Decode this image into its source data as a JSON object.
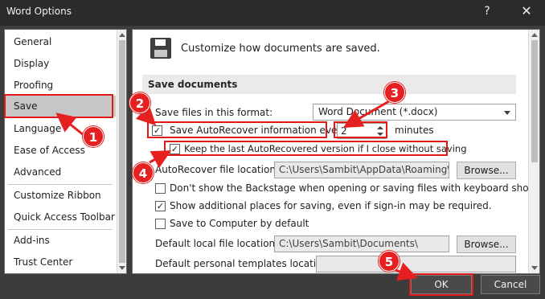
{
  "window": {
    "title": "Word Options",
    "help_label": "?",
    "close_label": "✕"
  },
  "sidebar": {
    "items": [
      {
        "label": "General"
      },
      {
        "label": "Display"
      },
      {
        "label": "Proofing"
      },
      {
        "label": "Save",
        "selected": true
      },
      {
        "label": "Language"
      },
      {
        "label": "Ease of Access"
      },
      {
        "label": "Advanced"
      },
      {
        "label": "Customize Ribbon"
      },
      {
        "label": "Quick Access Toolbar"
      },
      {
        "label": "Add-ins"
      },
      {
        "label": "Trust Center"
      }
    ]
  },
  "main": {
    "header_text": "Customize how documents are saved.",
    "header_icon": "floppy-disk-icon",
    "section_title": "Save documents",
    "save_format_label": "Save files in this format:",
    "save_format_value": "Word Document (*.docx)",
    "autorecover_label": "Save AutoRecover information every",
    "autorecover_checked": true,
    "autorecover_minutes_value": "2",
    "minutes_label": "minutes",
    "keep_last_label": "Keep the last AutoRecovered version if I close without saving",
    "keep_last_checked": true,
    "autorecover_location_label": "AutoRecover file location:",
    "autorecover_location_value": "C:\\Users\\Sambit\\AppData\\Roaming\\Microsoft\\Word\\",
    "browse_label": "Browse...",
    "dont_show_backstage_label": "Don't show the Backstage when opening or saving files with keyboard shortcuts",
    "dont_show_backstage_checked": false,
    "show_additional_label": "Show additional places for saving, even if sign-in may be required.",
    "show_additional_checked": true,
    "save_to_computer_label": "Save to Computer by default",
    "save_to_computer_checked": false,
    "default_local_label": "Default local file location:",
    "default_local_value": "C:\\Users\\Sambit\\Documents\\",
    "default_templates_label": "Default personal templates location:",
    "default_templates_value": ""
  },
  "footer": {
    "ok_label": "OK",
    "cancel_label": "Cancel"
  },
  "annotations": {
    "color": "#e62020",
    "badges": [
      "1",
      "2",
      "3",
      "4",
      "5"
    ]
  },
  "colors": {
    "titlebar_bg": "#2b2b2b",
    "dialog_bg": "#3c3c3c",
    "selected_nav": "#c6c6c6",
    "annotation_red": "#e01818"
  }
}
